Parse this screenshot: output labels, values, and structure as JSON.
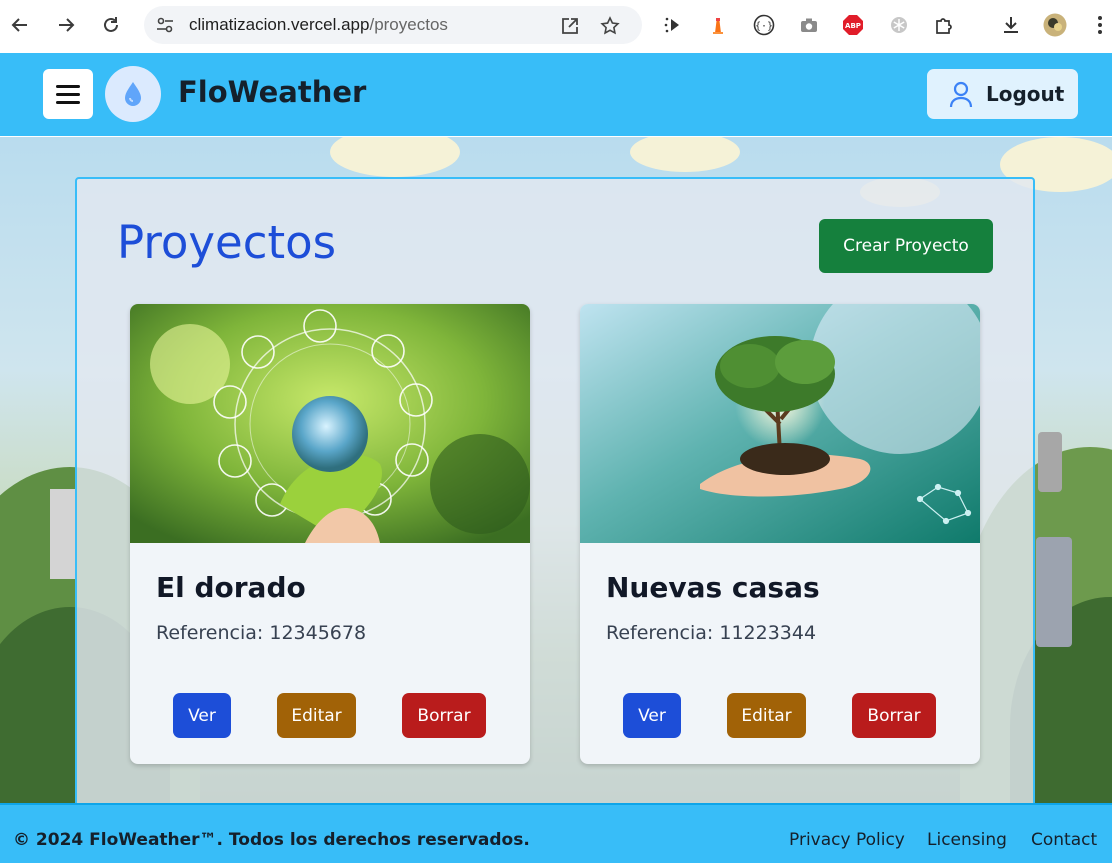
{
  "browser": {
    "url_host": "climatizacion.vercel.app",
    "url_path": "/proyectos"
  },
  "header": {
    "brand": "FloWeather",
    "logout_label": "Logout"
  },
  "page": {
    "title": "Proyectos",
    "create_label": "Crear Proyecto"
  },
  "projects": [
    {
      "name": "El dorado",
      "reference": "Referencia: 12345678",
      "view_label": "Ver",
      "edit_label": "Editar",
      "delete_label": "Borrar"
    },
    {
      "name": "Nuevas casas",
      "reference": "Referencia: 11223344",
      "view_label": "Ver",
      "edit_label": "Editar",
      "delete_label": "Borrar"
    }
  ],
  "footer": {
    "copyright": "© 2024 FloWeather™. Todos los derechos reservados.",
    "links": [
      "Privacy Policy",
      "Licensing",
      "Contact"
    ]
  },
  "colors": {
    "header": "#38bdf8",
    "title": "#1d4ed8",
    "create": "#15803d",
    "view": "#1d4ed8",
    "edit": "#a16207",
    "delete": "#b91c1c"
  },
  "icons": {
    "extensions": [
      "cursor-sparkle-icon",
      "lighthouse-icon",
      "code-braces-icon",
      "camera-icon",
      "adblock-icon",
      "snowflake-icon",
      "puzzle-icon",
      "download-icon",
      "profile-avatar-icon",
      "more-vert-icon"
    ]
  }
}
